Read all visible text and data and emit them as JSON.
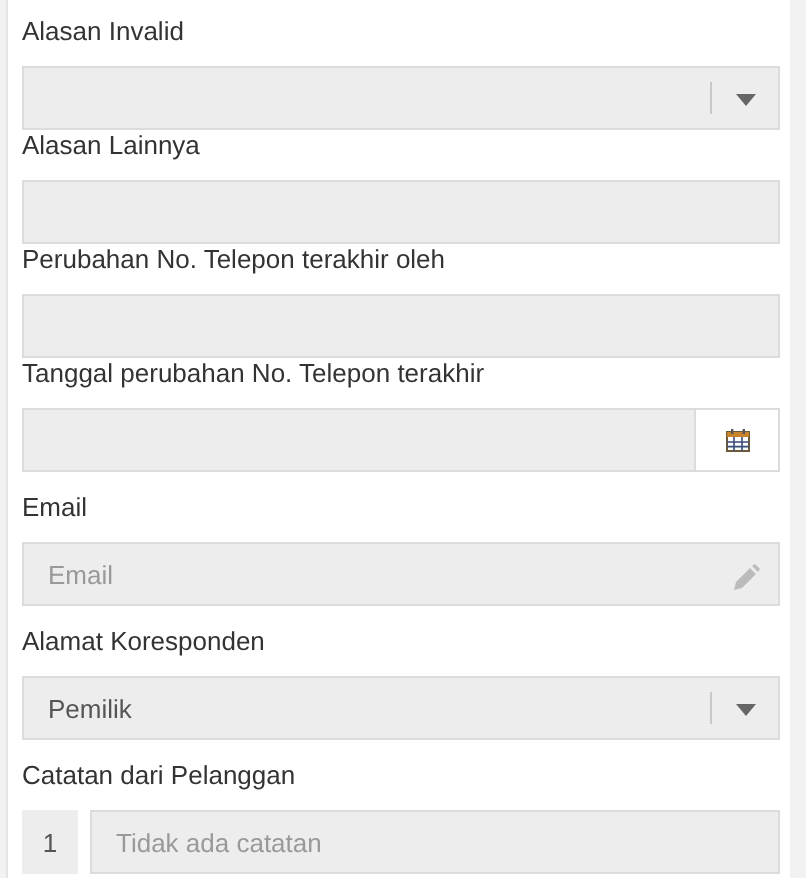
{
  "fields": [
    {
      "label": "Alasan Invalid",
      "kind": "select"
    },
    {
      "label": "Alasan Lainnya",
      "kind": "text"
    },
    {
      "label": "Perubahan No. Telepon terakhir oleh",
      "kind": "text"
    },
    {
      "label": "Tanggal perubahan No. Telepon terakhir",
      "kind": "date"
    },
    {
      "label": "Email",
      "kind": "email",
      "placeholder": "Email"
    },
    {
      "label": "Alamat Koresponden",
      "kind": "select",
      "value": "Pemilik"
    },
    {
      "label": "Catatan dari Pelanggan",
      "kind": "notes",
      "notes": [
        {
          "number": "1",
          "placeholder": "Tidak ada catatan"
        }
      ]
    }
  ]
}
